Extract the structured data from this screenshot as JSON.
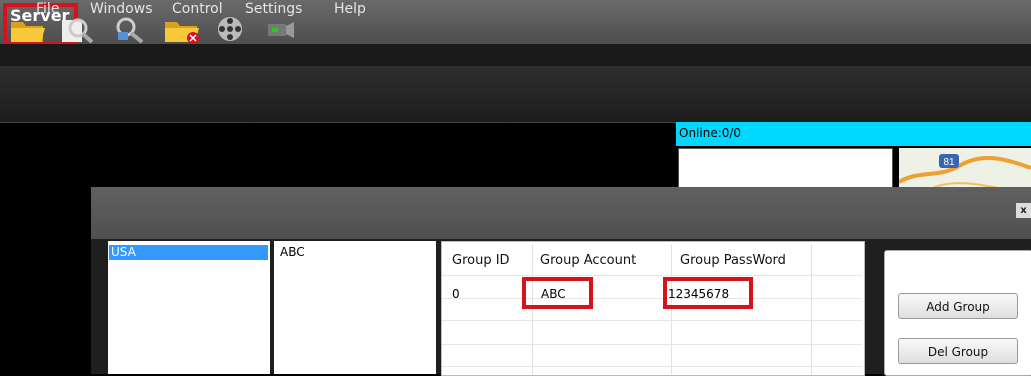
{
  "app": {
    "title": "Server"
  },
  "menu": [
    "File",
    "Windows",
    "Control",
    "Settings",
    "Help"
  ],
  "toolbar_icons": [
    "open-folder-icon",
    "search-icon",
    "remote-search-icon",
    "delete-folder-icon",
    "video-reel-icon",
    "camera-icon"
  ],
  "video": {
    "online_status": "Online:0/0",
    "map_label": "81"
  },
  "dialog": {
    "close_label": "x",
    "countries": [
      "USA"
    ],
    "groups": [
      "ABC"
    ],
    "table": {
      "headers": [
        "Group ID",
        "Group Account",
        "Group PassWord"
      ],
      "rows": [
        {
          "id": "0",
          "account": "ABC",
          "password": "12345678"
        }
      ]
    },
    "buttons": {
      "add": "Add Group",
      "del": "Del Group"
    }
  },
  "colors": {
    "highlight": "#d6121d",
    "online_bar": "#00d8ff",
    "selection": "#3399ff"
  }
}
